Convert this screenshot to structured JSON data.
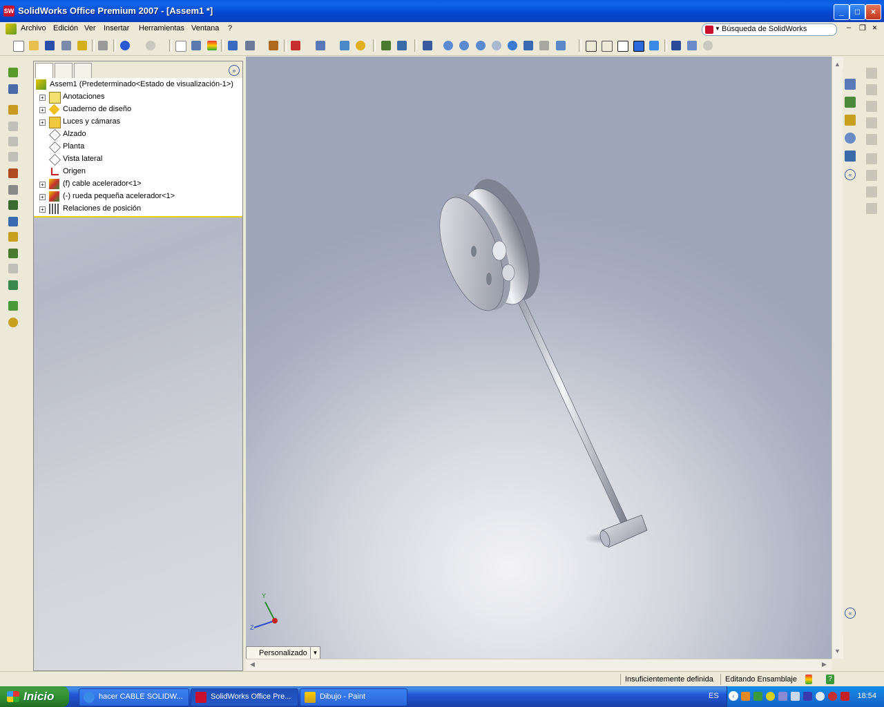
{
  "window": {
    "title": "SolidWorks Office Premium 2007 - [Assem1 *]",
    "logo_text": "SW"
  },
  "menubar": {
    "items": [
      "Archivo",
      "Edición",
      "Ver",
      "Insertar",
      "Herramientas",
      "Ventana",
      "?"
    ],
    "search_text": "Búsqueda de SolidWorks"
  },
  "feature_tree": {
    "root": "Assem1  (Predeterminado<Estado de visualización-1>)",
    "items": [
      {
        "label": "Anotaciones",
        "icon": "annotations-icon",
        "expandable": true
      },
      {
        "label": "Cuaderno de diseño",
        "icon": "design-binder-icon",
        "expandable": true
      },
      {
        "label": "Luces y cámaras",
        "icon": "lights-cameras-icon",
        "expandable": true
      },
      {
        "label": "Alzado",
        "icon": "plane-icon",
        "expandable": false
      },
      {
        "label": "Planta",
        "icon": "plane-icon",
        "expandable": false
      },
      {
        "label": "Vista lateral",
        "icon": "plane-icon",
        "expandable": false
      },
      {
        "label": "Origen",
        "icon": "origin-icon",
        "expandable": false
      },
      {
        "label": "(f) cable acelerador<1>",
        "icon": "part-icon",
        "expandable": true
      },
      {
        "label": "(-) rueda pequeña acelerador<1>",
        "icon": "part-icon",
        "expandable": true
      },
      {
        "label": "Relaciones de posición",
        "icon": "mates-icon",
        "expandable": true
      }
    ]
  },
  "viewport": {
    "view_tab_label": "Personalizado",
    "triad": {
      "y_label": "Y",
      "z_label": "Z"
    }
  },
  "statusbar": {
    "definition_state": "Insuficientemente definida",
    "mode": "Editando Ensamblaje"
  },
  "taskbar": {
    "start_label": "Inicio",
    "tasks": [
      {
        "label": "hacer CABLE SOLIDW...",
        "icon": "internet-explorer-icon",
        "active": false
      },
      {
        "label": "SolidWorks Office Pre...",
        "icon": "solidworks-icon",
        "active": true
      },
      {
        "label": "Dibujo - Paint",
        "icon": "paint-icon",
        "active": false
      }
    ],
    "language": "ES",
    "clock": "18:54"
  }
}
